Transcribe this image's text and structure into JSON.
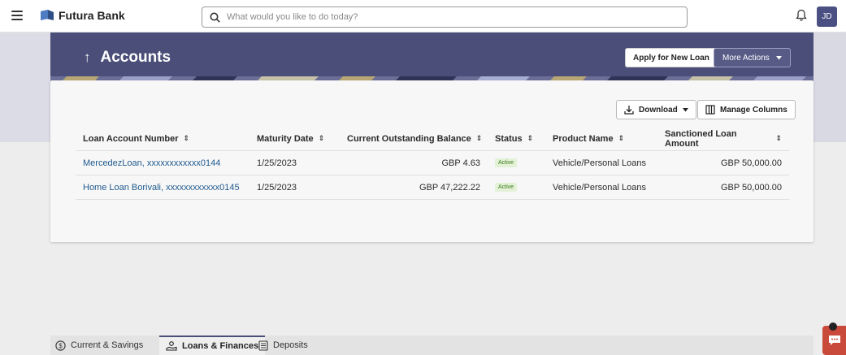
{
  "app": {
    "brand": "Futura Bank",
    "user_initials": "JD"
  },
  "search": {
    "placeholder": "What would you like to do today?"
  },
  "header": {
    "title": "Accounts",
    "back_arrow": "↑",
    "apply_label": "Apply for New Loan",
    "more_actions_label": "More Actions"
  },
  "toolbar": {
    "download_label": "Download",
    "manage_columns_label": "Manage Columns"
  },
  "table": {
    "columns": [
      "Loan Account Number",
      "Maturity Date",
      "Current Outstanding Balance",
      "Status",
      "Product Name",
      "Sanctioned Loan Amount"
    ],
    "rows": [
      {
        "account": "MercedezLoan, xxxxxxxxxxxx0144",
        "maturity": "1/25/2023",
        "balance": "GBP 4.63",
        "status": "Active",
        "product": "Vehicle/Personal Loans",
        "sanctioned": "GBP 50,000.00"
      },
      {
        "account": "Home Loan Borivali, xxxxxxxxxxxx0145",
        "maturity": "1/25/2023",
        "balance": "GBP 47,222.22",
        "status": "Active",
        "product": "Vehicle/Personal Loans",
        "sanctioned": "GBP 50,000.00"
      }
    ]
  },
  "tabs": [
    {
      "label": "Current & Savings",
      "icon": "dollar-circle-icon"
    },
    {
      "label": "Loans & Finances",
      "icon": "loan-hand-icon",
      "active": true
    },
    {
      "label": "Deposits",
      "icon": "deposit-icon"
    }
  ],
  "colors": {
    "brand": "#4a4e78",
    "link": "#1f5a8f",
    "active_badge_bg": "#e3f1d6",
    "chat": "#c94a3a"
  }
}
